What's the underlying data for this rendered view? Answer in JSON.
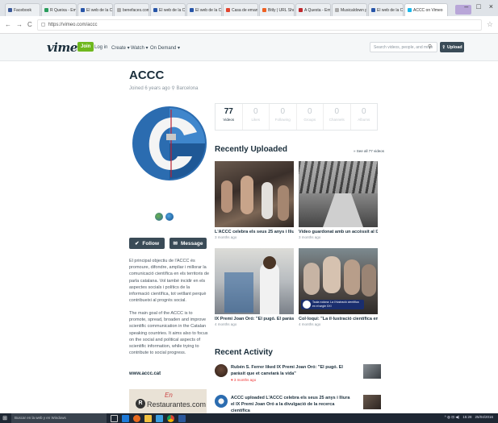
{
  "browser": {
    "tabs": [
      {
        "label": "Facebook",
        "color": "#3b5998"
      },
      {
        "label": "R Queixa - Em",
        "color": "#2a9d5c"
      },
      {
        "label": "El web de la Ci",
        "color": "#2855a8"
      },
      {
        "label": "benefaces.com",
        "color": "#aaaaaa"
      },
      {
        "label": "El web de la Ci",
        "color": "#2855a8"
      },
      {
        "label": "El web de la Ci",
        "color": "#2855a8"
      },
      {
        "label": "Casa de eman",
        "color": "#e1442f"
      },
      {
        "label": "Bitly | URL Sho",
        "color": "#ee6123"
      },
      {
        "label": "A Questa - Em",
        "color": "#c0282d"
      },
      {
        "label": "Musicaldown p",
        "color": "#aaaaaa"
      },
      {
        "label": "El web de la Ci",
        "color": "#2855a8"
      },
      {
        "label": "ACCC on Vimeo",
        "color": "#1ab7ea"
      }
    ],
    "url": "https://vimeo.com/accc",
    "window_controls": [
      "–",
      "□",
      "×"
    ]
  },
  "header": {
    "logo": "vimeo",
    "join": "Join",
    "nav": [
      "Log in",
      "Create ▾",
      "Watch ▾",
      "On Demand ▾"
    ],
    "search_placeholder": "Search videos, people, and more",
    "upload": "Upload"
  },
  "profile": {
    "name": "ACCC",
    "joined": "Joined 6 years ago",
    "location": "Barcelona",
    "follow": "Follow",
    "message": "Message",
    "bio": [
      "El principal objectiu de l'ACCC és promoure, difondre, ampliar i millorar la comunicació científica en els territoris de parla catalana. Vol també incidir en els aspectes socials i polítics de la informació científica, tot vetllant perquè contribueixi al progrés social.",
      "The main goal of the ACCC is to promote, spread, broaden and improve scientific communication in the Catalan speaking countries. It aims also to focus on the social and political aspects of scientific information, while trying to contribute to social progress."
    ],
    "website": "www.accc.cat"
  },
  "ad": {
    "brand": "Restaurantes.com",
    "logo_letter": "R",
    "script": "En"
  },
  "stats": [
    {
      "value": "77",
      "label": "Videos"
    },
    {
      "value": "0",
      "label": "Likes"
    },
    {
      "value": "0",
      "label": "Following"
    },
    {
      "value": "0",
      "label": "Groups"
    },
    {
      "value": "0",
      "label": "Channels"
    },
    {
      "value": "0",
      "label": "Albums"
    }
  ],
  "recent_uploaded": {
    "title": "Recently Uploaded",
    "see_all": "» See all 77 videos",
    "videos": [
      {
        "title": "L'ACCC celebra els seus 25 anys i lliura el I...",
        "age": "3 months ago"
      },
      {
        "title": "Vídeo guardonat amb un accèssit al IX Prem...",
        "age": "3 months ago"
      },
      {
        "title": "IX Premi Joan Oró: \"El pugó. El paràsit que ...",
        "age": "4 months ago"
      },
      {
        "title": "Col·loqui: \"La il·lustració científica en el seg...",
        "age": "4 months ago",
        "badge": "Taula rodona: La il·lustració científica en el segle XXI"
      }
    ]
  },
  "recent_activity": {
    "title": "Recent Activity",
    "items": [
      {
        "text": "Rubén S. Ferrer liked IX Premi Joan Oró: \"El pugó. El paràsit que et canviarà la vida\"",
        "meta": "♥ 3 months ago"
      },
      {
        "text": "ACCC uploaded L'ACCC celebra els seus 25 anys i lliura el IX Premi Joan Oró a la divulgació de la recerca científica",
        "meta": ""
      }
    ]
  },
  "taskbar": {
    "search": "Buscar en la web y en Windows",
    "time": "15:28",
    "date": "25/04/2016"
  }
}
